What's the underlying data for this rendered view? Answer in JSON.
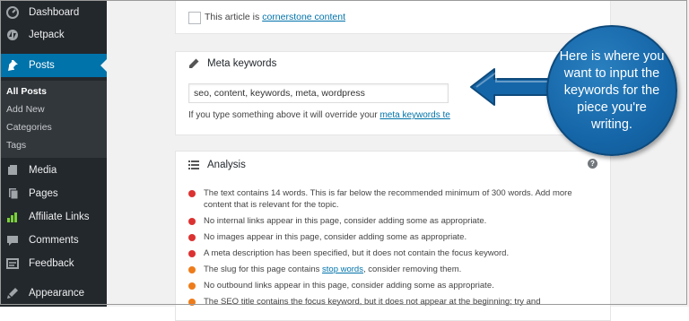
{
  "sidebar": {
    "items": [
      {
        "label": "Dashboard",
        "icon": "dashboard-icon"
      },
      {
        "label": "Jetpack",
        "icon": "jetpack-icon"
      },
      {
        "label": "Posts",
        "icon": "pin-icon"
      },
      {
        "label": "Media",
        "icon": "media-icon"
      },
      {
        "label": "Pages",
        "icon": "pages-icon"
      },
      {
        "label": "Affiliate Links",
        "icon": "affiliate-links-icon"
      },
      {
        "label": "Comments",
        "icon": "comments-icon"
      },
      {
        "label": "Feedback",
        "icon": "feedback-icon"
      },
      {
        "label": "Appearance",
        "icon": "appearance-icon"
      }
    ],
    "active": "Posts",
    "submenu": [
      "All Posts",
      "Add New",
      "Categories",
      "Tags"
    ],
    "submenu_current": "All Posts"
  },
  "cornerstone": {
    "text": "This article is",
    "link": "cornerstone content"
  },
  "meta_keywords": {
    "title": "Meta keywords",
    "value": "seo, content, keywords, meta, wordpress",
    "note": "If you type something above it will override your",
    "note_link": "meta keywords te"
  },
  "analysis": {
    "title": "Analysis",
    "help": "?",
    "results": [
      {
        "status": "red",
        "text": "The text contains 14 words. This is far below the recommended minimum of 300 words. Add more content that is relevant for the topic."
      },
      {
        "status": "red",
        "text": "No internal links appear in this page, consider adding some as appropriate."
      },
      {
        "status": "red",
        "text": "No images appear in this page, consider adding some as appropriate."
      },
      {
        "status": "red",
        "text": "A meta description has been specified, but it does not contain the focus keyword."
      },
      {
        "status": "orange",
        "text_before": "The slug for this page contains",
        "link": "stop words",
        "text_after": ", consider removing them."
      },
      {
        "status": "orange",
        "text": "No outbound links appear in this page, consider adding some as appropriate."
      },
      {
        "status": "orange",
        "text": "The SEO title contains the focus keyword, but it does not appear at the beginning; try and"
      }
    ]
  },
  "callout": {
    "text": "Here is where you want to input the keywords for the piece you're writing."
  },
  "colors": {
    "sidebar": "#23282d",
    "active": "#0073aa",
    "red_dot": "#dc3232",
    "orange_dot": "#ee7c1b",
    "callout": "#1566a8"
  }
}
